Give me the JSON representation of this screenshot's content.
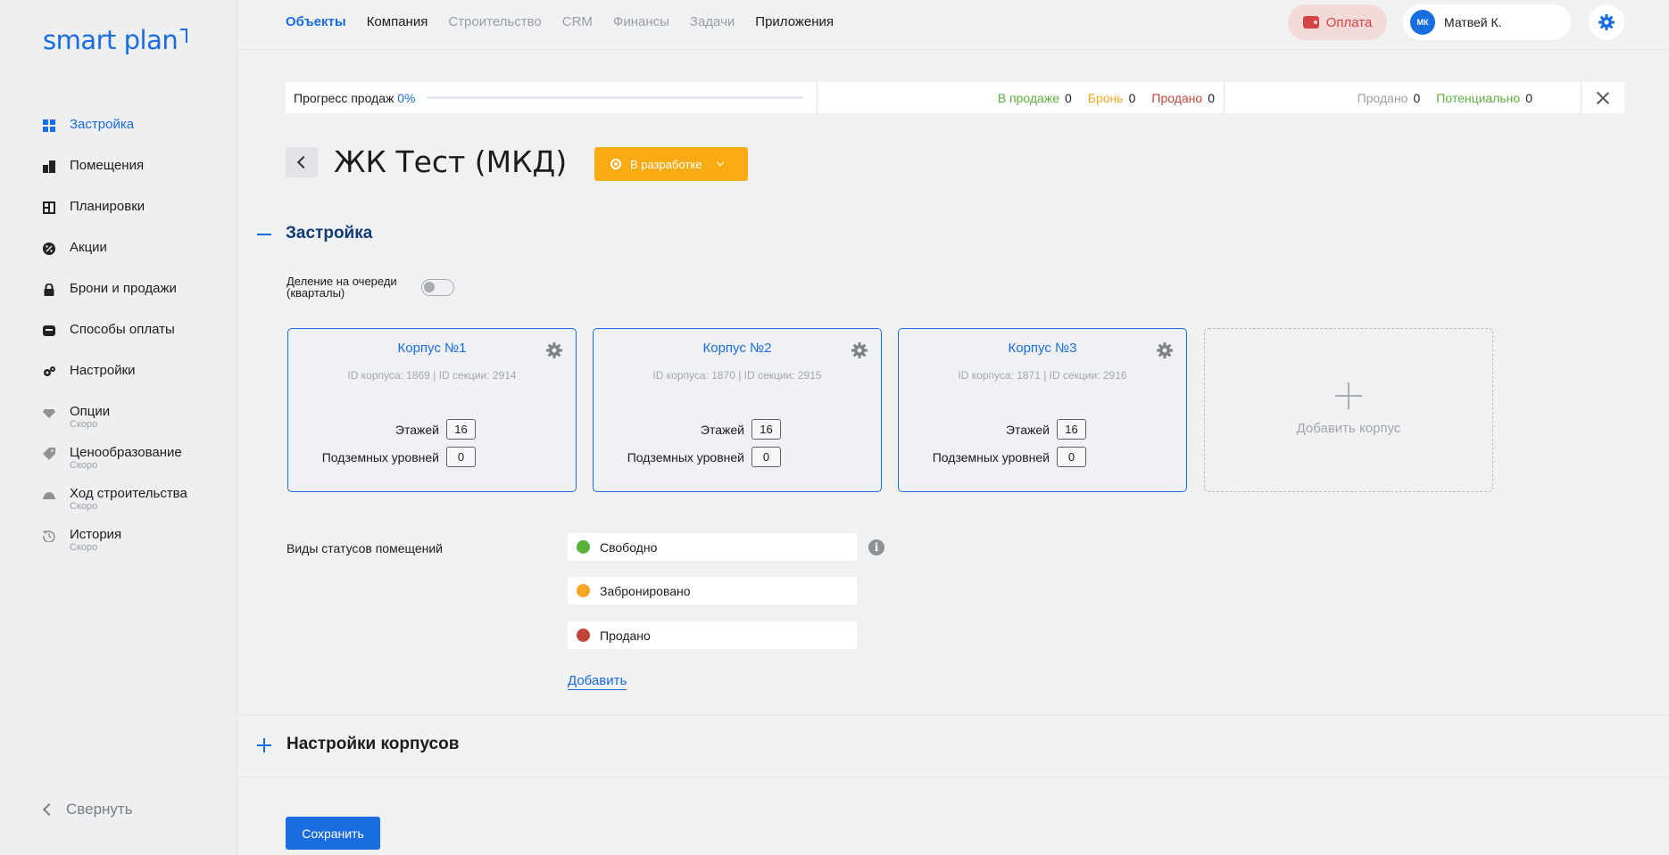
{
  "logo": "smart plan",
  "sidebar": {
    "items": [
      {
        "label": "Застройка",
        "icon": "grid-icon",
        "soon": ""
      },
      {
        "label": "Помещения",
        "icon": "building-icon",
        "soon": ""
      },
      {
        "label": "Планировки",
        "icon": "floorplan-icon",
        "soon": ""
      },
      {
        "label": "Акции",
        "icon": "promo-icon",
        "soon": ""
      },
      {
        "label": "Брони и продажи",
        "icon": "lock-icon",
        "soon": ""
      },
      {
        "label": "Способы оплаты",
        "icon": "wallet-icon",
        "soon": ""
      },
      {
        "label": "Настройки",
        "icon": "gears-icon",
        "soon": ""
      },
      {
        "label": "Опции",
        "icon": "diamond-icon",
        "soon": "Скоро"
      },
      {
        "label": "Ценообразование",
        "icon": "tag-icon",
        "soon": "Скоро"
      },
      {
        "label": "Ход строительства",
        "icon": "helmet-icon",
        "soon": "Скоро"
      },
      {
        "label": "История",
        "icon": "history-icon",
        "soon": "Скоро"
      }
    ],
    "collapse_label": "Свернуть"
  },
  "topnav": {
    "items": [
      "Объекты",
      "Компания",
      "Строительство",
      "CRM",
      "Финансы",
      "Задачи",
      "Приложения"
    ]
  },
  "header": {
    "pay_label": "Оплата",
    "user_initials": "МК",
    "user_name": "Матвей К."
  },
  "progress": {
    "label": "Прогресс продаж",
    "percent": "0%",
    "fill_fraction": 0,
    "on_sale_label": "В продаже",
    "on_sale": "0",
    "booked_label": "Бронь",
    "booked": "0",
    "sold_label": "Продано",
    "sold": "0",
    "sold2_label": "Продано",
    "sold2": "0",
    "potential_label": "Потенциально",
    "potential": "0"
  },
  "page": {
    "title": "ЖК Тест (МКД)",
    "status_label": "В разработке"
  },
  "section": {
    "title": "Застройка",
    "split_label": "Деление на очереди (кварталы)",
    "add_building": "Добавить корпус",
    "floors_label": "Этажей",
    "underground_label": "Подземных уровней"
  },
  "buildings": [
    {
      "title": "Корпус №1",
      "ids": "ID корпуса: 1869 | ID секции: 2914",
      "floors": "16",
      "underground": "0"
    },
    {
      "title": "Корпус №2",
      "ids": "ID корпуса: 1870 | ID секции: 2915",
      "floors": "16",
      "underground": "0"
    },
    {
      "title": "Корпус №3",
      "ids": "ID корпуса: 1871 | ID секции: 2916",
      "floors": "16",
      "underground": "0"
    }
  ],
  "statuses": {
    "label": "Виды статусов помещений",
    "items": [
      {
        "label": "Свободно",
        "color": "#5ab03b"
      },
      {
        "label": "Забронировано",
        "color": "#f5a623"
      },
      {
        "label": "Продано",
        "color": "#c0453b"
      }
    ],
    "add_label": "Добавить"
  },
  "section2": {
    "title": "Настройки корпусов"
  },
  "save_label": "Сохранить",
  "colors": {
    "accent": "#1a6de0",
    "status_dev": "#fbab12"
  }
}
